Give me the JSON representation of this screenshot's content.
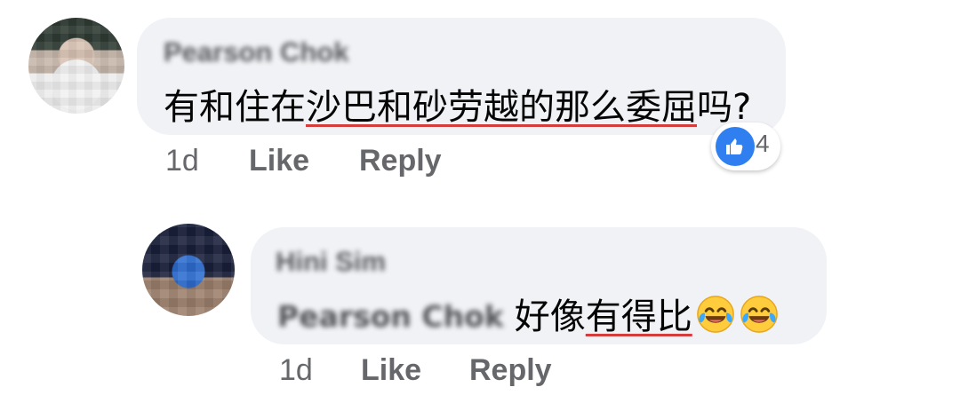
{
  "comments": [
    {
      "author": "Pearson Chok",
      "text": {
        "prefix": "有和住在",
        "underlined": "沙巴和砂劳越的那么委屈",
        "suffix": "吗?"
      },
      "meta": {
        "time": "1d",
        "like": "Like",
        "reply": "Reply"
      },
      "reactions": {
        "icon": "thumbs-up-icon",
        "count": "4"
      }
    },
    {
      "author": "Hini Sim",
      "mention": "Pearson Chok",
      "text": {
        "prefix": "好像",
        "underlined": "有得比"
      },
      "emojis": [
        "face-with-tears-of-joy-icon",
        "face-with-tears-of-joy-icon"
      ],
      "meta": {
        "time": "1d",
        "like": "Like",
        "reply": "Reply"
      }
    }
  ],
  "colors": {
    "bubble": "#f0f2f5",
    "meta_text": "#65676b",
    "reaction_blue": "#2f7ff1",
    "underline_red": "#d53c3c"
  }
}
